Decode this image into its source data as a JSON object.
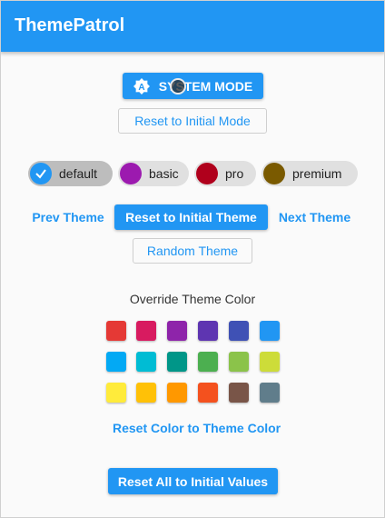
{
  "app": {
    "title": "ThemePatrol"
  },
  "mode": {
    "system_label": "SYSTEM MODE",
    "system_icon": "auto-mode-icon",
    "reset_label": "Reset to Initial Mode"
  },
  "themes": {
    "chips": [
      {
        "label": "default",
        "color": "#2196f3",
        "selected": true
      },
      {
        "label": "basic",
        "color": "#9c1aaf",
        "selected": false
      },
      {
        "label": "pro",
        "color": "#b0001c",
        "selected": false
      },
      {
        "label": "premium",
        "color": "#7a5a00",
        "selected": false
      }
    ],
    "prev_label": "Prev Theme",
    "reset_label": "Reset to Initial Theme",
    "next_label": "Next Theme",
    "random_label": "Random Theme"
  },
  "override": {
    "label": "Override Theme Color",
    "colors": [
      "#e53935",
      "#d81b60",
      "#8e24aa",
      "#5e35b1",
      "#3f51b5",
      "#2196f3",
      "#03a9f4",
      "#00bcd4",
      "#009688",
      "#4caf50",
      "#8bc34a",
      "#cddc39",
      "#ffeb3b",
      "#ffc107",
      "#ff9800",
      "#f4511e",
      "#795548",
      "#607d8b"
    ],
    "reset_label": "Reset Color to Theme Color"
  },
  "footer": {
    "reset_all_label": "Reset All to Initial Values"
  }
}
